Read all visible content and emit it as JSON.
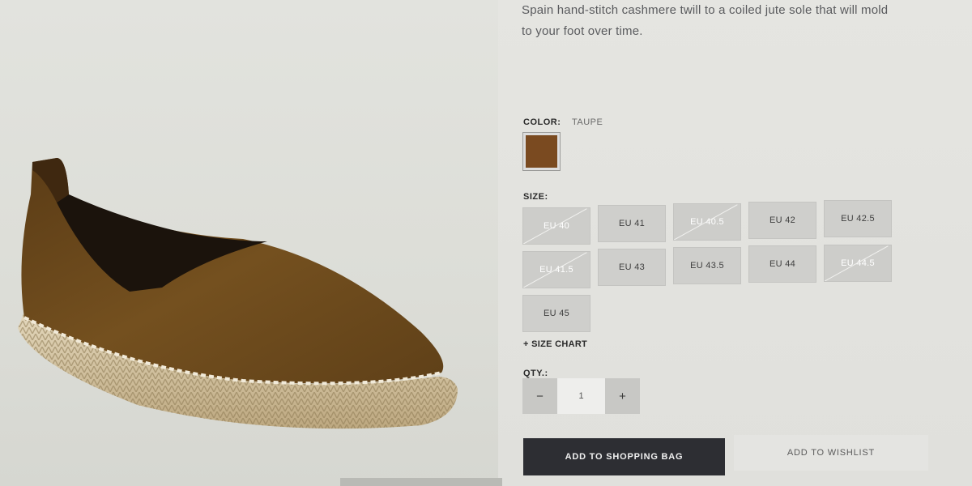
{
  "product": {
    "description_lines": [
      "Spain hand-stitch cashmere twill to a coiled jute sole that will mold",
      "to your foot over time."
    ],
    "image_alt": "brown espadrille"
  },
  "color": {
    "label": "COLOR:",
    "value": "TAUPE",
    "swatch_hex": "#7a4a20"
  },
  "size": {
    "label": "SIZE:",
    "options": [
      {
        "label": "EU 40",
        "available": false
      },
      {
        "label": "EU 41",
        "available": true
      },
      {
        "label": "EU 40.5",
        "available": false
      },
      {
        "label": "EU 42",
        "available": true
      },
      {
        "label": "EU 42.5",
        "available": true
      },
      {
        "label": "EU 41.5",
        "available": false
      },
      {
        "label": "EU 43",
        "available": true
      },
      {
        "label": "EU 43.5",
        "available": true
      },
      {
        "label": "EU 44",
        "available": true
      },
      {
        "label": "EU 44.5",
        "available": false
      },
      {
        "label": "EU 45",
        "available": true
      }
    ],
    "chart_link": "+ SIZE CHART"
  },
  "quantity": {
    "label": "QTY.:",
    "minus": "−",
    "value": "1",
    "plus": "+"
  },
  "actions": {
    "add_to_bag": "ADD TO SHOPPING BAG",
    "add_to_wishlist": "ADD TO WISHLIST"
  },
  "colors": {
    "page_bg": "#e0e0dc",
    "button_dark": "#2d2e33",
    "size_button": "#cfcfcc",
    "shoe_canvas": "#6e4a1e",
    "jute": "#d9c9a6"
  }
}
